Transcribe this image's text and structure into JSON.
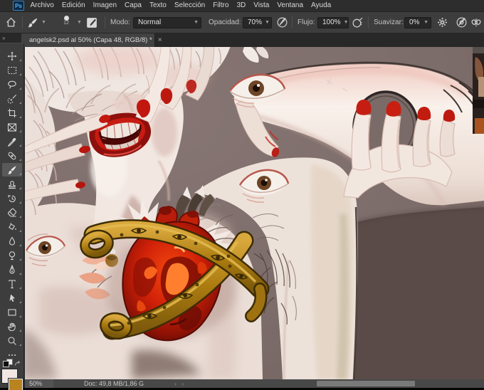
{
  "app": "Adobe Photoshop",
  "logo_text": "Ps",
  "menu": {
    "items": [
      "Archivo",
      "Edición",
      "Imagen",
      "Capa",
      "Texto",
      "Selección",
      "Filtro",
      "3D",
      "Vista",
      "Ventana",
      "Ayuda"
    ]
  },
  "options_bar": {
    "brush_size": "12",
    "mode_label": "Modo:",
    "mode_value": "Normal",
    "opacity_label": "Opacidad:",
    "opacity_value": "70%",
    "flow_label": "Flujo:",
    "flow_value": "100%",
    "smoothing_label": "Suavizar:",
    "smoothing_value": "0%",
    "icons": [
      "home-icon",
      "brush-preset-icon",
      "toggle-brush-panel-icon",
      "pressure-opacity-icon",
      "airbrush-icon",
      "gear-icon",
      "pressure-size-icon",
      "symmetry-icon"
    ]
  },
  "tab": {
    "title": "angelsk2.psd al 50% (Capa 48, RGB/8) *",
    "close": "×",
    "dock_collapse": "»"
  },
  "toolbar": {
    "tools": [
      "move",
      "marquee",
      "lasso",
      "quick-selection",
      "crop",
      "frame",
      "eyedropper",
      "healing-brush",
      "brush",
      "clone-stamp",
      "history-brush",
      "eraser",
      "paint-bucket",
      "blur",
      "dodge",
      "pen",
      "type",
      "path-selection",
      "rectangle",
      "hand",
      "zoom"
    ],
    "selected_tool": "brush",
    "more_label": "···",
    "foreground_color": "#f3e5e1",
    "background_color": "#b9831f"
  },
  "statusbar": {
    "zoom_value": "50%",
    "doc_info": "Doc: 49,8 MB/1,86 G",
    "scroll_right": "›",
    "scroll_left": "‹"
  },
  "canvas": {
    "artwork_palette": {
      "background_mauve": "#7d6d6b",
      "background_dark": "#5a4b49",
      "skin_light": "#f4ede8",
      "skin_shadow": "#cdb3ab",
      "red_mouth": "#c21a10",
      "heart_red": "#e02c0c",
      "heart_orange": "#ff7f2e",
      "gold_belt": "#b2820f",
      "eye_iris_brown": "#6e4526"
    }
  }
}
